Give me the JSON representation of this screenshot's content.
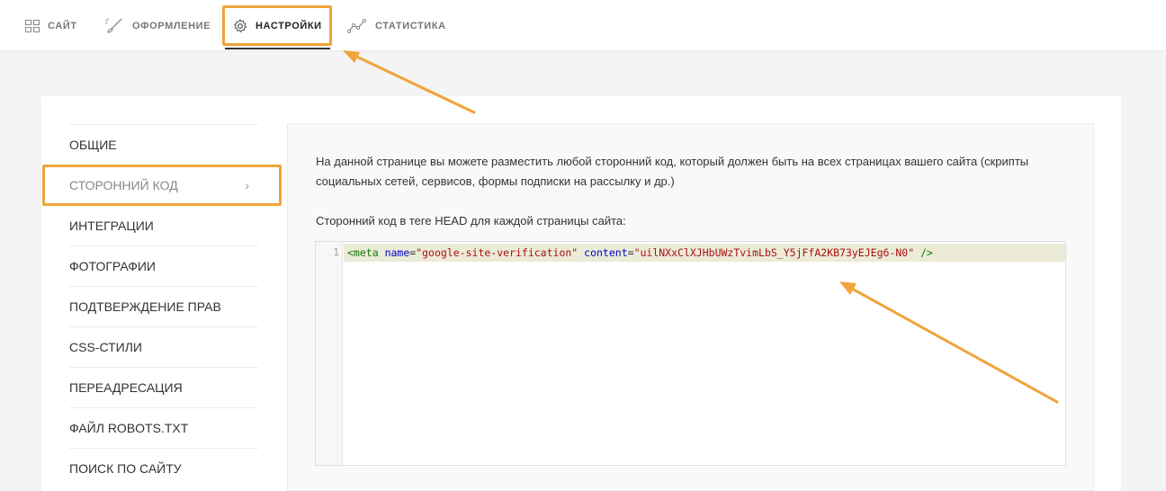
{
  "topnav": {
    "items": [
      {
        "label": "САЙТ",
        "icon": "grid-icon"
      },
      {
        "label": "ОФОРМЛЕНИЕ",
        "icon": "brush-icon"
      },
      {
        "label": "НАСТРОЙКИ",
        "icon": "gear-icon",
        "active": true
      },
      {
        "label": "СТАТИСТИКА",
        "icon": "chart-line-icon"
      }
    ]
  },
  "sidebar": {
    "items": [
      {
        "label": "ОБЩИЕ"
      },
      {
        "label": "СТОРОННИЙ КОД",
        "active": true,
        "chevron": "›"
      },
      {
        "label": "ИНТЕГРАЦИИ"
      },
      {
        "label": "ФОТОГРАФИИ"
      },
      {
        "label": "ПОДТВЕРЖДЕНИЕ ПРАВ"
      },
      {
        "label": "CSS-СТИЛИ"
      },
      {
        "label": "ПЕРЕАДРЕСАЦИЯ"
      },
      {
        "label": "ФАЙЛ ROBOTS.TXT"
      },
      {
        "label": "ПОИСК ПО САЙТУ"
      }
    ]
  },
  "main": {
    "description": "На данной странице вы можете разместить любой сторонний код, который должен быть на всех страницах вашего сайта (скрипты социальных сетей, сервисов, формы подписки на рассылку и др.)",
    "head_label": "Сторонний код в теге HEAD для каждой страницы сайта:",
    "editor": {
      "line_number": "1",
      "tokens": {
        "open": "<meta",
        "attr1": "name",
        "eq1": "=",
        "val1": "\"google-site-verification\"",
        "attr2": "content",
        "eq2": "=",
        "val2": "\"uilNXxClXJHbUWzTvimLbS_Y5jFfA2KB73yEJEg6-N0\"",
        "close": "/>"
      }
    }
  },
  "colors": {
    "highlight": "#f0a43a",
    "active_underline": "#333333",
    "code_line_bg": "#ebebd8"
  }
}
